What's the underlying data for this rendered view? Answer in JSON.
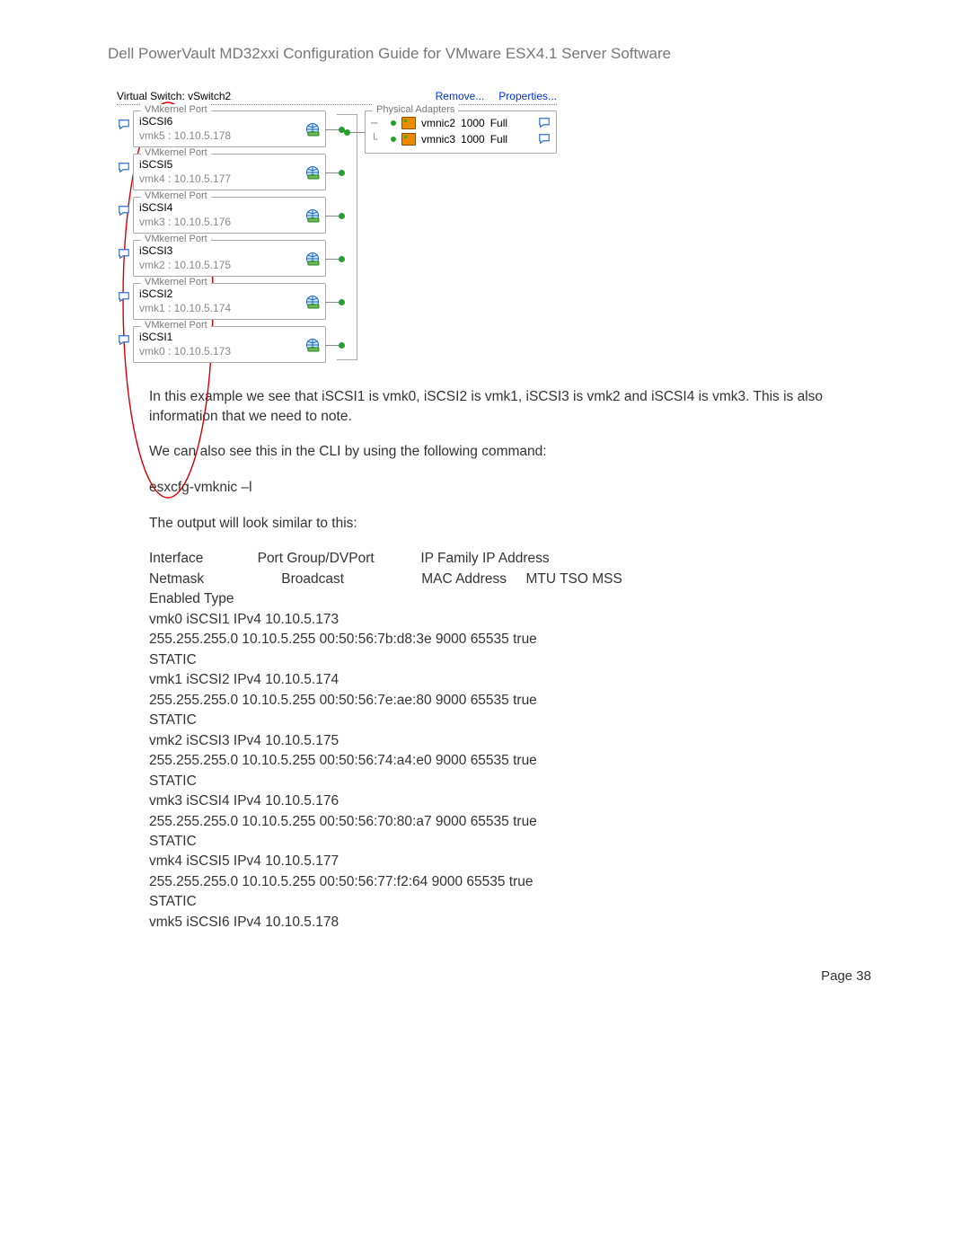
{
  "doc": {
    "title": "Dell PowerVault MD32xxi Configuration Guide for VMware ESX4.1 Server Software",
    "page_label": "Page 38"
  },
  "vswitch": {
    "title": "Virtual Switch: vSwitch2",
    "remove": "Remove...",
    "properties": "Properties...",
    "ports_legend": "VMkernel Port",
    "adapters_legend": "Physical Adapters",
    "ports": [
      {
        "name": "iSCSI6",
        "ip": "vmk5 : 10.10.5.178",
        "dot": "#22a12b"
      },
      {
        "name": "iSCSI5",
        "ip": "vmk4 : 10.10.5.177",
        "dot": "#22a12b"
      },
      {
        "name": "iSCSI4",
        "ip": "vmk3 : 10.10.5.176",
        "dot": "#22a12b"
      },
      {
        "name": "iSCSI3",
        "ip": "vmk2 : 10.10.5.175",
        "dot": "#22a12b"
      },
      {
        "name": "iSCSI2",
        "ip": "vmk1 : 10.10.5.174",
        "dot": "#22a12b"
      },
      {
        "name": "iSCSI1",
        "ip": "vmk0 : 10.10.5.173",
        "dot": "#22a12b"
      }
    ],
    "adapters": [
      {
        "tree": "─",
        "name": "vmnic2",
        "speed": "1000",
        "duplex": "Full"
      },
      {
        "tree": "└",
        "name": "vmnic3",
        "speed": "1000",
        "duplex": "Full"
      }
    ]
  },
  "body": {
    "p1": "In this example we see that iSCSI1 is vmk0, iSCSI2 is vmk1, iSCSI3 is vmk2 and iSCSI4 is vmk3.  This is also information that we need to note.",
    "p2": "We can also see this in the CLI by using the following command:",
    "cmd": "esxcfg-vmknic –l",
    "p3": "The output will look similar to this:",
    "headers": "Interface              Port Group/DVPort            IP Family IP Address\nNetmask                    Broadcast                    MAC Address     MTU TSO MSS\nEnabled Type",
    "rows": [
      "vmk0 iSCSI1 IPv4 10.10.5.173",
      "255.255.255.0 10.10.5.255 00:50:56:7b:d8:3e 9000 65535 true",
      "STATIC",
      "vmk1 iSCSI2 IPv4 10.10.5.174",
      "255.255.255.0 10.10.5.255 00:50:56:7e:ae:80 9000 65535 true",
      "STATIC",
      "vmk2 iSCSI3 IPv4 10.10.5.175",
      "255.255.255.0 10.10.5.255 00:50:56:74:a4:e0 9000 65535 true",
      "STATIC",
      "vmk3 iSCSI4 IPv4 10.10.5.176",
      "255.255.255.0 10.10.5.255 00:50:56:70:80:a7 9000 65535 true",
      "STATIC",
      "vmk4 iSCSI5 IPv4 10.10.5.177",
      "255.255.255.0 10.10.5.255 00:50:56:77:f2:64 9000 65535 true",
      "STATIC",
      "vmk5 iSCSI6 IPv4 10.10.5.178"
    ]
  }
}
